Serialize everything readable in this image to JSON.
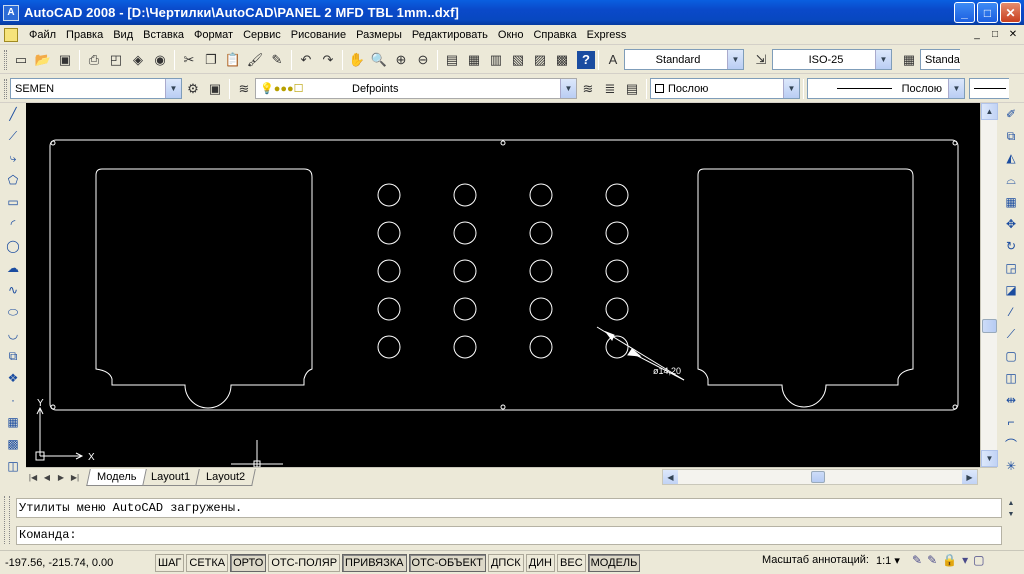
{
  "window": {
    "title": "AutoCAD 2008 - [D:\\Чертилки\\AutoCAD\\PANEL 2 MFD TBL 1mm..dxf]",
    "app_icon_text": "A",
    "minimize": "_",
    "maximize": "□",
    "close": "✕"
  },
  "menu": {
    "items": [
      "Файл",
      "Правка",
      "Вид",
      "Вставка",
      "Формат",
      "Сервис",
      "Рисование",
      "Размеры",
      "Редактировать",
      "Окно",
      "Справка",
      "Express"
    ],
    "doc_controls": [
      "_",
      "□",
      "✕"
    ]
  },
  "toolbar1": {
    "text_style": "Standard",
    "dim_style": "ISO-25",
    "table_style": "Standa"
  },
  "toolbar2": {
    "workspace": "SEMEN",
    "layer": "Defpoints",
    "color": "Послою",
    "linetype": "Послою"
  },
  "drawing": {
    "dimension_text": "ø14,20",
    "ucs_x": "X",
    "ucs_y": "Y",
    "hole_rows": 5,
    "hole_cols": 4
  },
  "tabs": {
    "items": [
      "Модель",
      "Layout1",
      "Layout2"
    ],
    "active": "Модель"
  },
  "command": {
    "history": "Утилиты меню AutoCAD загружены.",
    "prompt": "Команда:"
  },
  "status": {
    "coordinates": "-197.56, -215.74, 0.00",
    "buttons": [
      "ШАГ",
      "СЕТКА",
      "ОРТО",
      "ОТС-ПОЛЯР",
      "ПРИВЯЗКА",
      "ОТС-ОБЪЕКТ",
      "ДПСК",
      "ДИН",
      "ВЕС",
      "МОДЕЛЬ"
    ],
    "buttons_on": [
      "ОРТО",
      "ПРИВЯЗКА",
      "ОТС-ОБЪЕКТ",
      "МОДЕЛЬ"
    ],
    "annotation_scale_label": "Масштаб аннотаций:",
    "annotation_scale": "1:1 ▾"
  }
}
